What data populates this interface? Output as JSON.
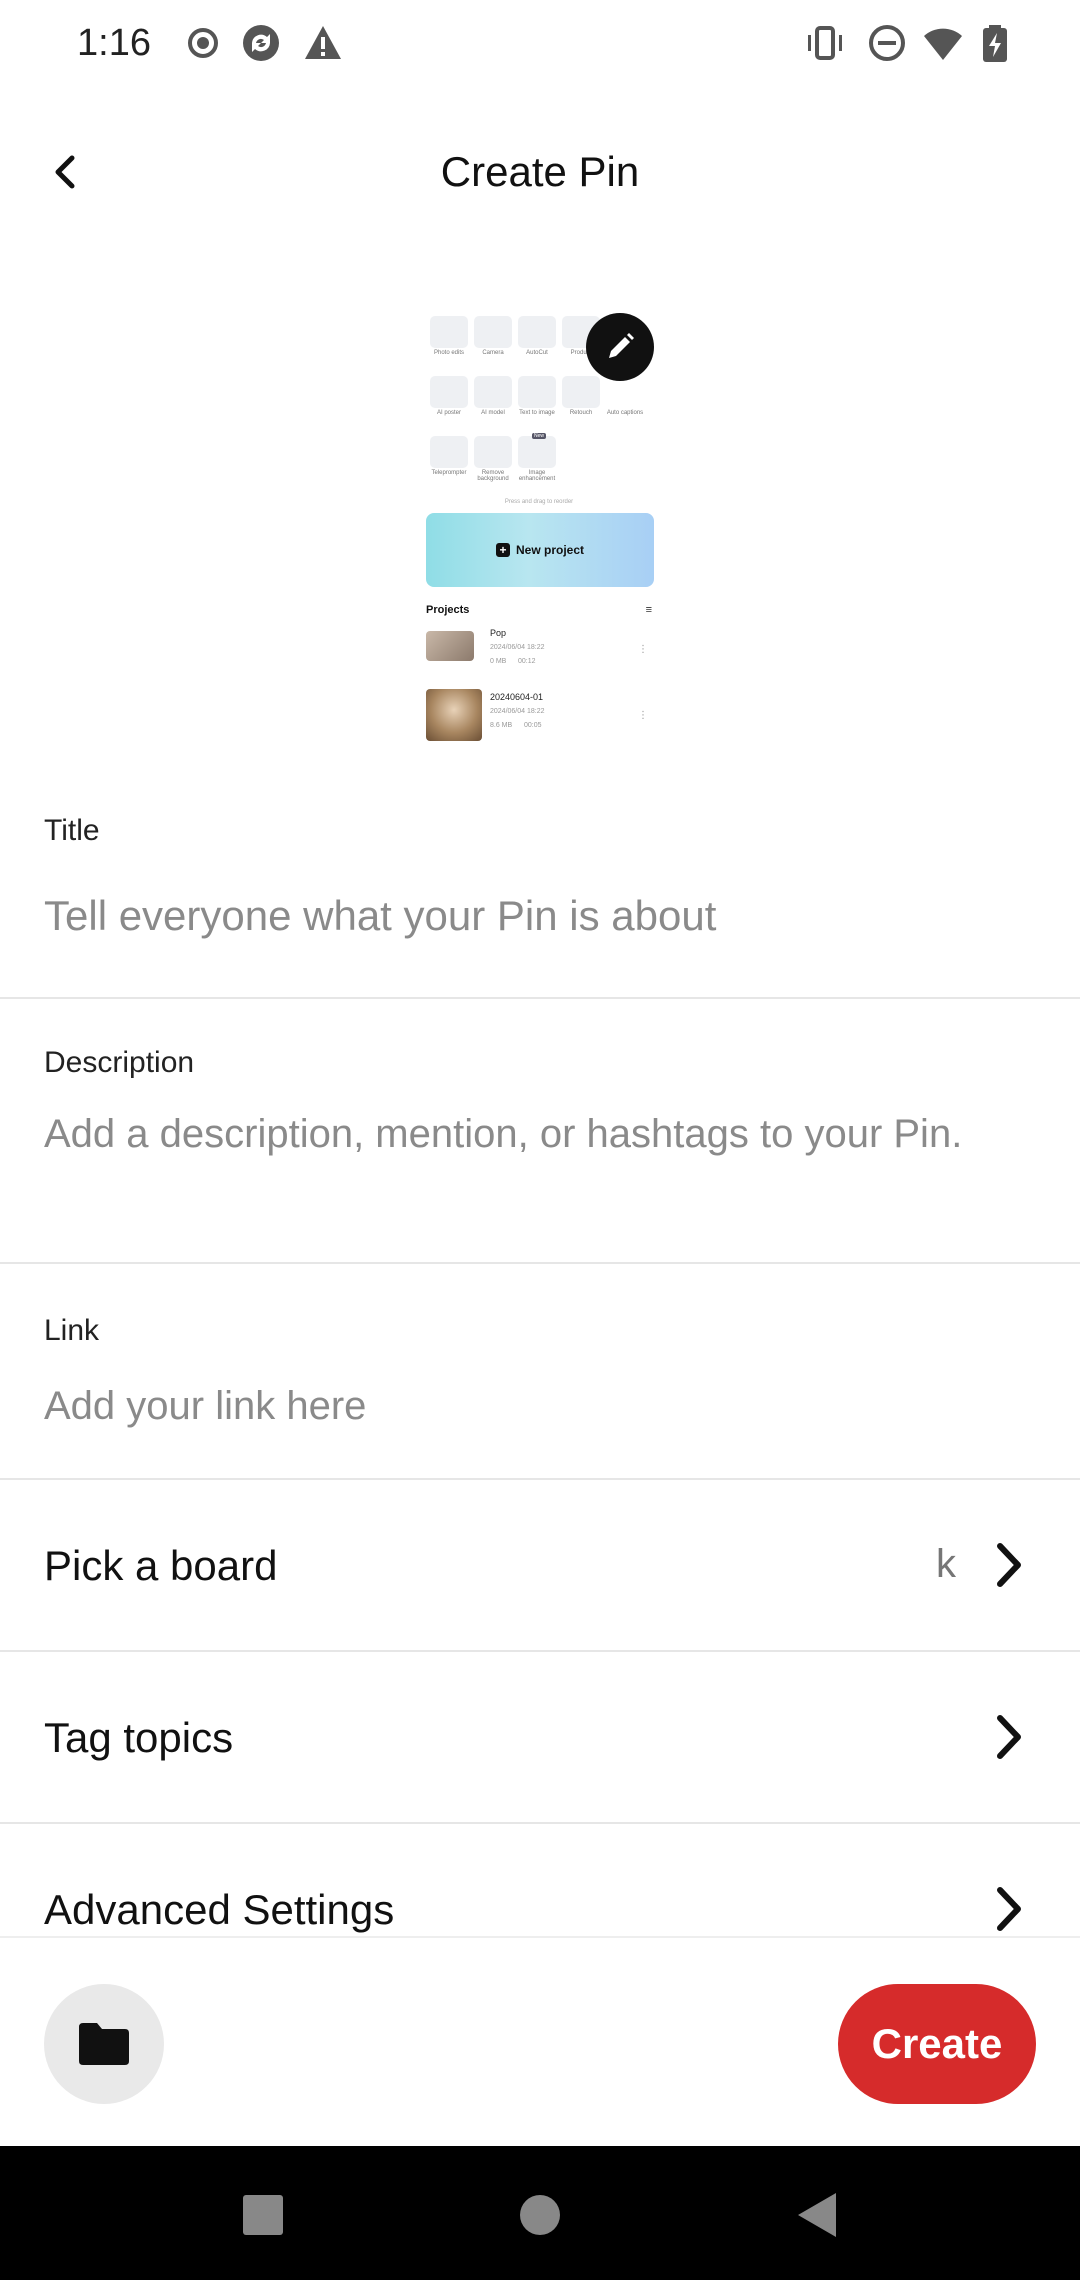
{
  "status_bar": {
    "time": "1:16",
    "left_icons": [
      "record-icon",
      "sync-icon",
      "warning-icon"
    ],
    "right_icons": [
      "vibrate-icon",
      "do-not-disturb-icon",
      "wifi-icon",
      "battery-charging-icon"
    ]
  },
  "header": {
    "title": "Create Pin",
    "back_icon": "chevron-left-icon"
  },
  "preview": {
    "tools_row1": [
      "Photo edits",
      "Camera",
      "AutoCut",
      "Product"
    ],
    "tools_row2": [
      "AI poster",
      "AI model",
      "Text to image",
      "Retouch",
      "Auto captions"
    ],
    "tools_row3": [
      "Teleprompter",
      "Remove background",
      "Image enhancement"
    ],
    "new_badge": "New",
    "hint": "Press and drag to reorder",
    "new_project": "New project",
    "projects_label": "Projects",
    "projects": [
      {
        "name": "Pop",
        "date": "2024/06/04 18:22",
        "size": "0 MB",
        "duration": "00:12"
      },
      {
        "name": "20240604-01",
        "date": "2024/06/04 18:22",
        "size": "8.6 MB",
        "duration": "00:05"
      }
    ],
    "edit_icon": "pencil-icon"
  },
  "form": {
    "title_label": "Title",
    "title_placeholder": "Tell everyone what your Pin is about",
    "description_label": "Description",
    "description_placeholder": "Add a description, mention, or hashtags to your Pin.",
    "link_label": "Link",
    "link_placeholder": "Add your link here"
  },
  "rows": {
    "board_label": "Pick a board",
    "board_value": "k",
    "topics_label": "Tag topics",
    "advanced_label": "Advanced Settings"
  },
  "actions": {
    "folder_icon": "folder-icon",
    "create_label": "Create"
  },
  "colors": {
    "accent": "#d62b2b",
    "placeholder": "#8a8a8a",
    "divider": "#e6e6e6"
  }
}
